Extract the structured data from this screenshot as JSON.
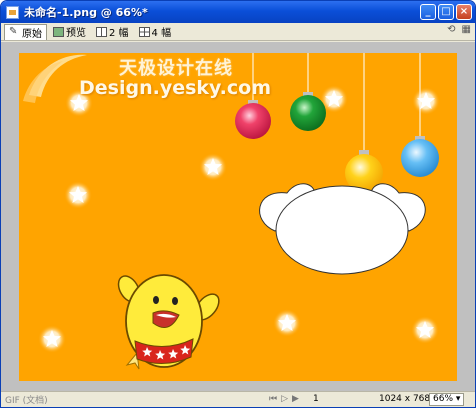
{
  "window": {
    "title": "未命名-1.png @  66%*",
    "controls": {
      "minimize": "_",
      "maximize": "□",
      "close": "×"
    }
  },
  "tabs": [
    {
      "label": "原始",
      "icon": "pen-icon",
      "active": true
    },
    {
      "label": "预览",
      "icon": "preview-icon",
      "active": false
    },
    {
      "label": "2 幅",
      "icon": "two-up-icon",
      "active": false
    },
    {
      "label": "4 幅",
      "icon": "four-up-icon",
      "active": false
    }
  ],
  "watermark": {
    "chinese": "天极设计在线",
    "english": "Design.yesky.com"
  },
  "canvas": {
    "background_color": "#ffa400",
    "ornament_colors": [
      "#f0426a",
      "#22a53a",
      "#ffd21a",
      "#66bff5"
    ]
  },
  "status": {
    "left": "GIF (文档)",
    "frame": "1",
    "dimensions": "1024 x 768",
    "zoom": "66%"
  }
}
